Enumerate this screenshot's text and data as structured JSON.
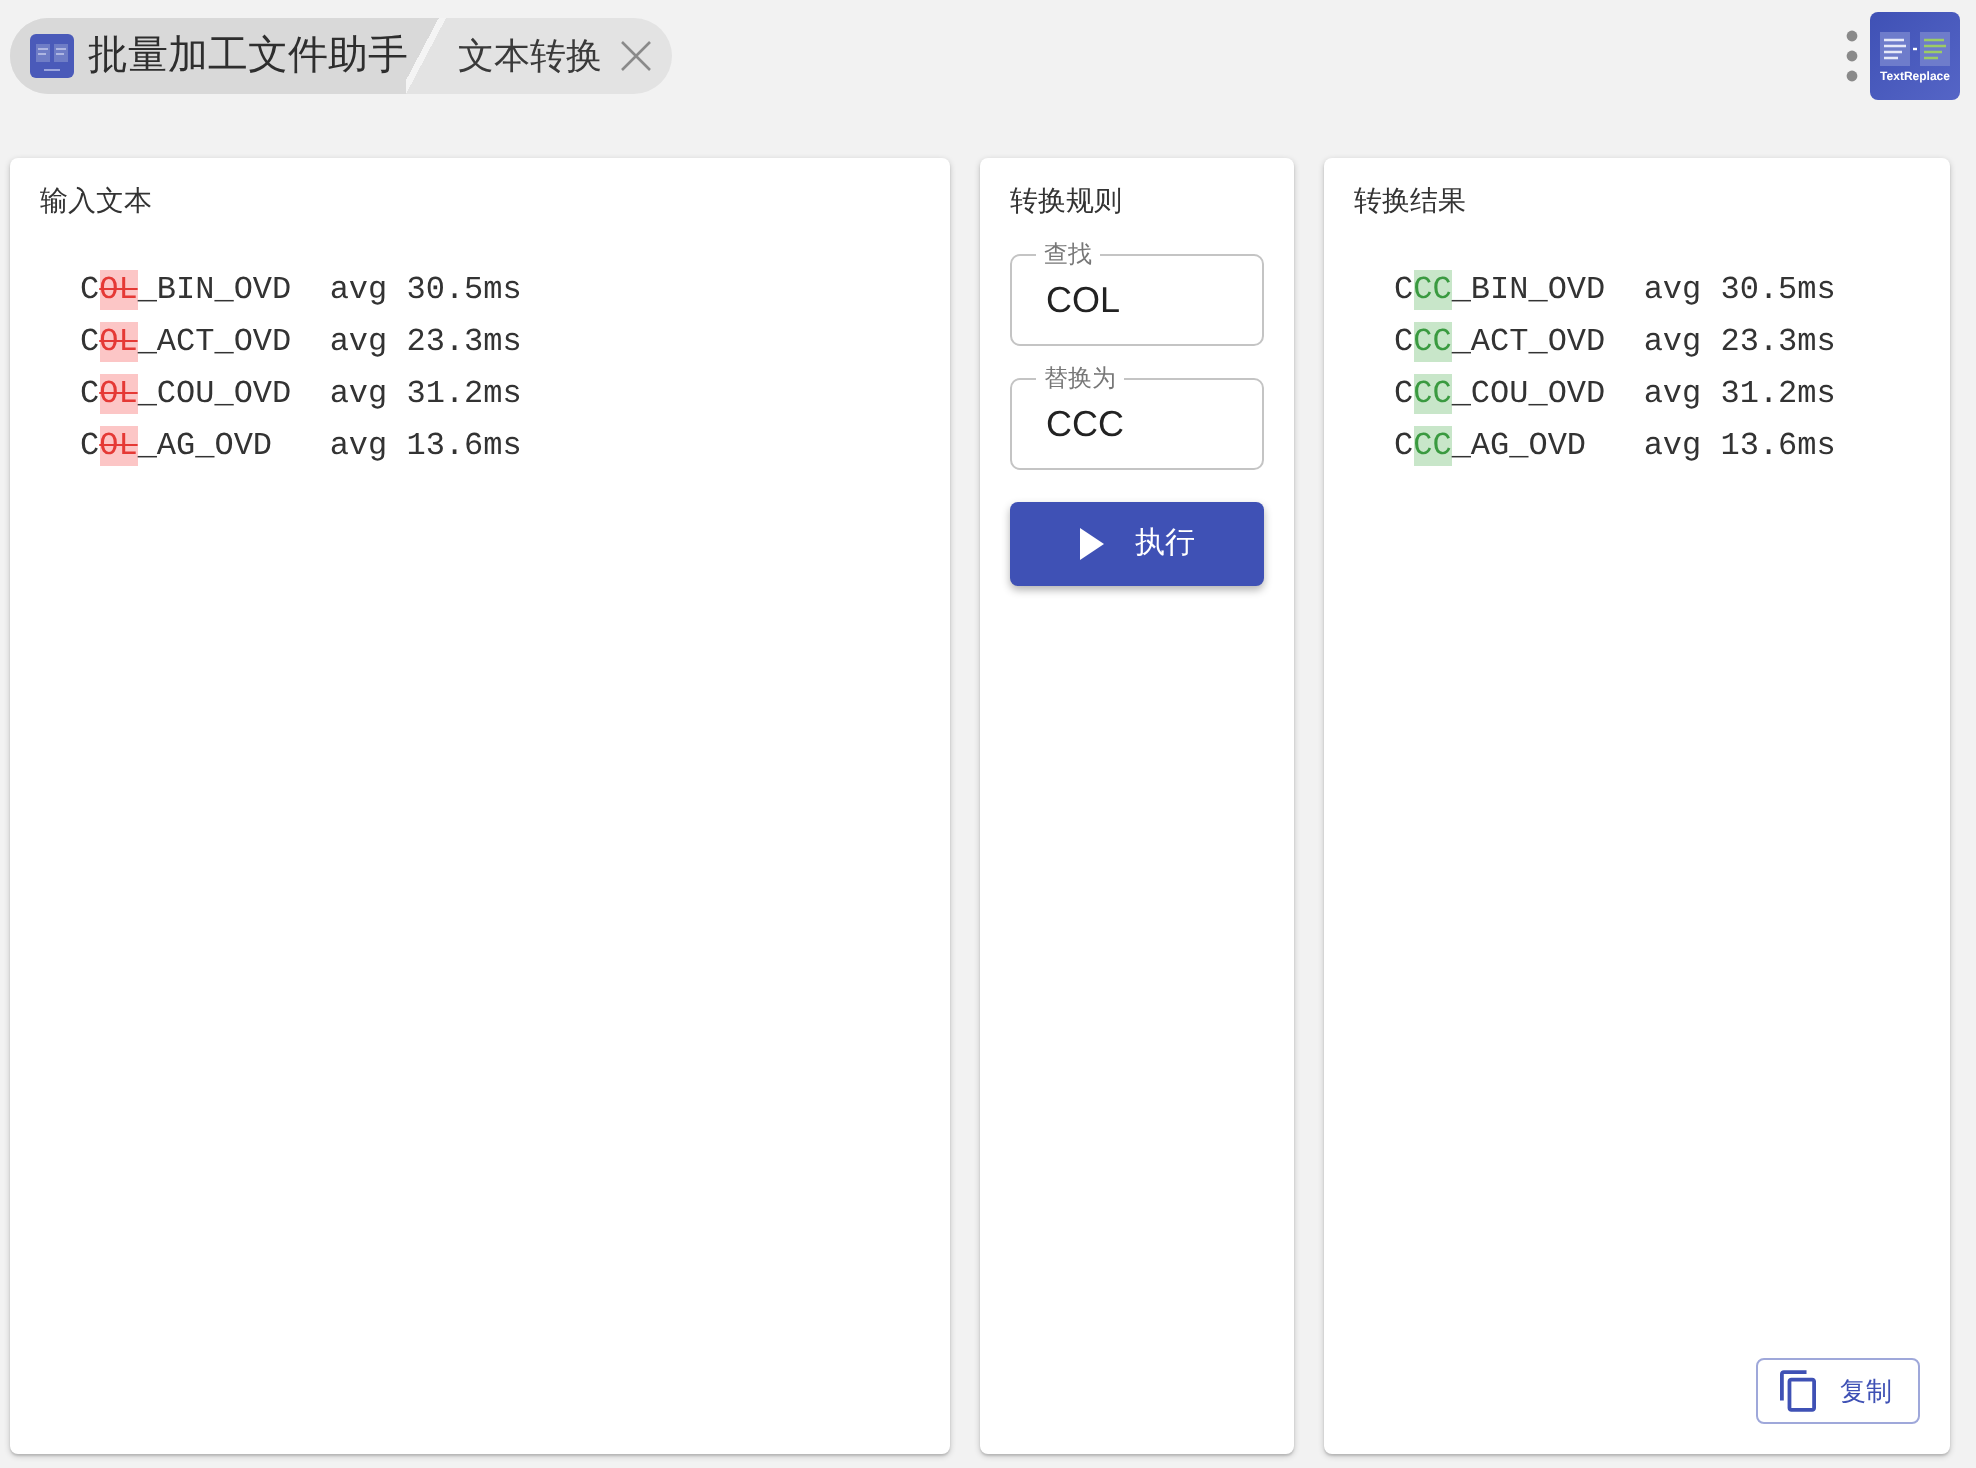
{
  "header": {
    "breadcrumbs": [
      {
        "kind": "root",
        "label": "批量加工文件助手"
      },
      {
        "kind": "current",
        "label": "文本转换",
        "closable": true
      }
    ],
    "logo": {
      "caption": "TextReplace"
    }
  },
  "input_panel": {
    "title": "输入文本",
    "lines": [
      {
        "segments": [
          {
            "kind": "plain",
            "text": "C"
          },
          {
            "kind": "removed",
            "text": "OL"
          },
          {
            "kind": "plain",
            "text": "_BIN_OVD  avg 30.5ms"
          }
        ]
      },
      {
        "segments": [
          {
            "kind": "plain",
            "text": "C"
          },
          {
            "kind": "removed",
            "text": "OL"
          },
          {
            "kind": "plain",
            "text": "_ACT_OVD  avg 23.3ms"
          }
        ]
      },
      {
        "segments": [
          {
            "kind": "plain",
            "text": "C"
          },
          {
            "kind": "removed",
            "text": "OL"
          },
          {
            "kind": "plain",
            "text": "_COU_OVD  avg 31.2ms"
          }
        ]
      },
      {
        "segments": [
          {
            "kind": "plain",
            "text": "C"
          },
          {
            "kind": "removed",
            "text": "OL"
          },
          {
            "kind": "plain",
            "text": "_AG_OVD   avg 13.6ms"
          }
        ]
      }
    ]
  },
  "rules_panel": {
    "title": "转换规则",
    "fields": [
      {
        "label": "查找",
        "value": "COL"
      },
      {
        "label": "替换为",
        "value": "CCC"
      }
    ],
    "run_button": {
      "label": "执行"
    }
  },
  "result_panel": {
    "title": "转换结果",
    "lines": [
      {
        "segments": [
          {
            "kind": "plain",
            "text": "C"
          },
          {
            "kind": "added",
            "text": "CC"
          },
          {
            "kind": "plain",
            "text": "_BIN_OVD  avg 30.5ms"
          }
        ]
      },
      {
        "segments": [
          {
            "kind": "plain",
            "text": "C"
          },
          {
            "kind": "added",
            "text": "CC"
          },
          {
            "kind": "plain",
            "text": "_ACT_OVD  avg 23.3ms"
          }
        ]
      },
      {
        "segments": [
          {
            "kind": "plain",
            "text": "C"
          },
          {
            "kind": "added",
            "text": "CC"
          },
          {
            "kind": "plain",
            "text": "_COU_OVD  avg 31.2ms"
          }
        ]
      },
      {
        "segments": [
          {
            "kind": "plain",
            "text": "C"
          },
          {
            "kind": "added",
            "text": "CC"
          },
          {
            "kind": "plain",
            "text": "_AG_OVD   avg 13.6ms"
          }
        ]
      }
    ],
    "copy_button": {
      "label": "复制"
    }
  }
}
